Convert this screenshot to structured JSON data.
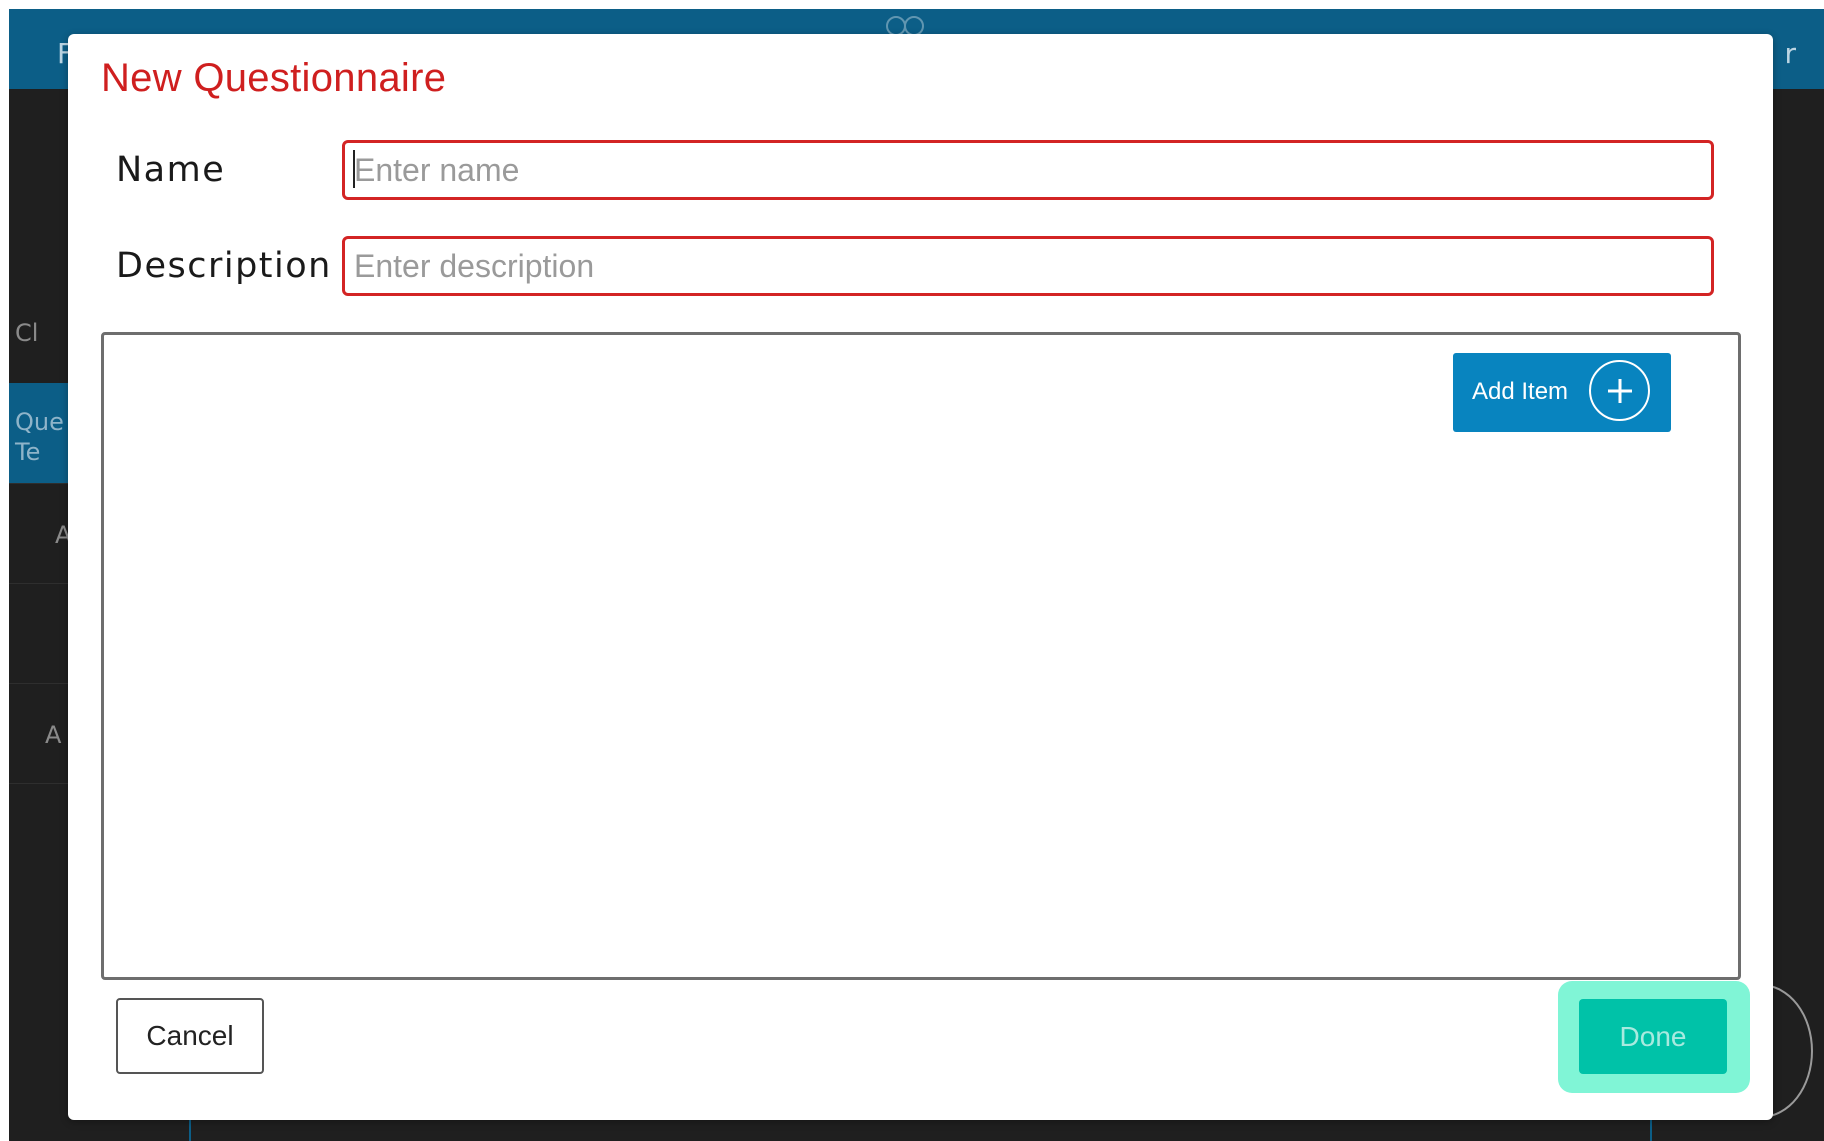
{
  "background": {
    "header_left_text": "F",
    "header_right_text": "r",
    "sidebar_items": [
      {
        "label": "Cl"
      },
      {
        "label": "Que Te"
      },
      {
        "label": "A"
      },
      {
        "label": ""
      },
      {
        "label": "A"
      }
    ]
  },
  "dialog": {
    "title": "New Questionnaire",
    "name_label": "Name",
    "name_placeholder": "Enter name",
    "name_value": "",
    "description_label": "Description",
    "description_placeholder": "Enter description",
    "description_value": "",
    "add_item_label": "Add Item",
    "cancel_label": "Cancel",
    "done_label": "Done"
  },
  "colors": {
    "title_red": "#cf1f1f",
    "input_border_red": "#d32424",
    "add_item_blue": "#0884bf",
    "done_teal": "#00c2a8",
    "done_highlight": "#80f5d6",
    "header_blue": "#0c5e87"
  },
  "icons": {
    "add_item_icon": "plus-circle-icon",
    "header_logo": "hands-logo-icon"
  }
}
